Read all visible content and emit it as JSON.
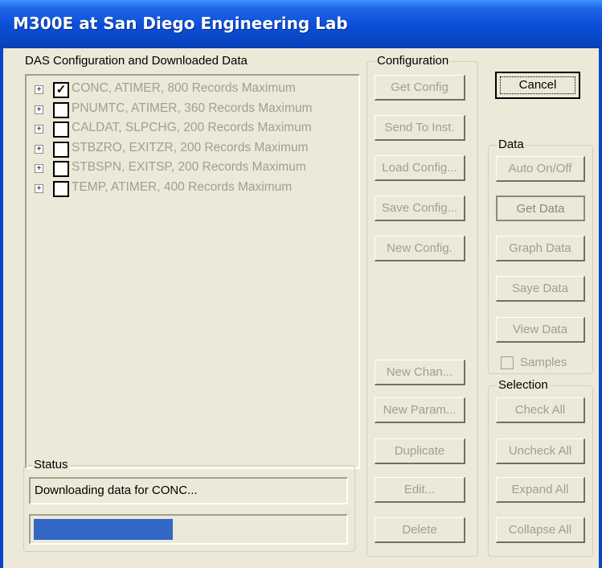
{
  "window": {
    "title": "M300E at San Diego Engineering Lab"
  },
  "das_panel": {
    "label": "DAS Configuration and Downloaded Data",
    "items": [
      {
        "label": "CONC, ATIMER, 800 Records Maximum",
        "checked": true
      },
      {
        "label": "PNUMTC, ATIMER, 360 Records Maximum",
        "checked": false
      },
      {
        "label": "CALDAT, SLPCHG, 200 Records Maximum",
        "checked": false
      },
      {
        "label": "STBZRO, EXITZR, 200 Records Maximum",
        "checked": false
      },
      {
        "label": "STBSPN, EXITSP, 200 Records Maximum",
        "checked": false
      },
      {
        "label": "TEMP, ATIMER, 400 Records Maximum",
        "checked": false
      }
    ]
  },
  "status": {
    "label": "Status",
    "message": "Downloading data for CONC...",
    "progress_fraction": 0.45
  },
  "configuration": {
    "label": "Configuration",
    "get_config": "Get Config",
    "send_to_inst": "Send To Inst.",
    "load_config": "Load Config...",
    "save_config": "Save Config...",
    "new_config": "New Config.",
    "new_chan": "New Chan...",
    "new_param": "New Param...",
    "duplicate": "Duplicate",
    "edit": "Edit...",
    "delete": "Delete"
  },
  "cancel_label": "Cancel",
  "data_group": {
    "label": "Data",
    "auto_on_off": "Auto On/Off",
    "get_data": "Get Data",
    "graph_data": "Graph Data",
    "save_data": "Saye Data",
    "view_data": "View Data",
    "samples_label": "Samples"
  },
  "selection_group": {
    "label": "Selection",
    "check_all": "Check All",
    "uncheck_all": "Uncheck All",
    "expand_all": "Expand All",
    "collapse_all": "Collapse All"
  },
  "colors": {
    "titlebar": "#0a4ed6",
    "progress": "#3468c8",
    "disabled_text": "#a0a08c"
  }
}
